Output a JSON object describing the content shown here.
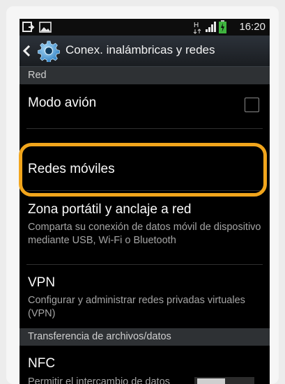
{
  "status_bar": {
    "time": "16:20",
    "icons": [
      "usb-debug-icon",
      "image-notification-icon",
      "h-plus-network-icon",
      "signal-icon",
      "battery-charging-icon"
    ]
  },
  "action_bar": {
    "title": "Conex. inalámbricas y redes",
    "icon": "gear-icon",
    "back_icon": "chevron-left-icon"
  },
  "sections": [
    {
      "header": "Red",
      "items": [
        {
          "title": "Modo avión",
          "control": "checkbox",
          "checked": false
        },
        {
          "title": "Redes móviles",
          "highlighted": true
        },
        {
          "title": "Zona portátil y anclaje a red",
          "summary": "Comparta su conexión de datos móvil de dispositivo mediante USB, Wi-Fi o Bluetooth"
        },
        {
          "title": "VPN",
          "summary": "Configurar y administrar redes privadas virtuales (VPN)"
        }
      ]
    },
    {
      "header": "Transferencia de archivos/datos",
      "items": [
        {
          "title": "NFC",
          "summary": "Permitir el intercambio de datos",
          "control": "toggle"
        }
      ]
    }
  ],
  "colors": {
    "highlight": "#f1a51c",
    "screen_background": "#000000",
    "section_header_bg": "#2e3134",
    "action_bar_bg": "#1f2328"
  }
}
